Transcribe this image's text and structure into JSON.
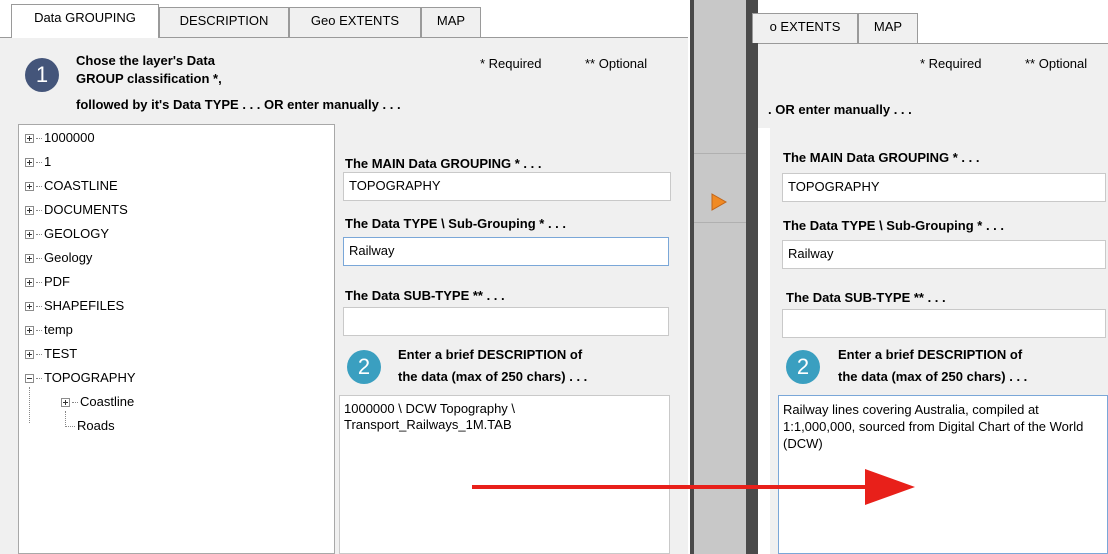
{
  "tabs": [
    "Data GROUPING",
    "DESCRIPTION",
    "Geo EXTENTS",
    "MAP"
  ],
  "right_tabs": [
    "o EXTENTS",
    "MAP"
  ],
  "header": {
    "step_number": "1",
    "line1": "Chose the layer's Data",
    "line2": "GROUP classification *,",
    "line3": "followed by it's Data TYPE . . . OR  enter manually . . .",
    "right_line3": ". OR  enter manually . . .",
    "required": "* Required",
    "optional": "** Optional"
  },
  "tree": {
    "items": [
      "1000000",
      "1",
      "COASTLINE",
      "DOCUMENTS",
      "GEOLOGY",
      "Geology",
      "PDF",
      "SHAPEFILES",
      "temp",
      "TEST",
      "TOPOGRAPHY"
    ],
    "children": [
      "Coastline",
      "Roads"
    ]
  },
  "form_left": {
    "main_label": "The MAIN Data GROUPING * . . .",
    "main_value": "TOPOGRAPHY",
    "type_label": "The Data TYPE \\ Sub-Grouping * . . .",
    "type_value": "Railway",
    "subtype_label": "The Data SUB-TYPE ** . . .",
    "subtype_value": "",
    "step2_number": "2",
    "desc_line1": "Enter a brief DESCRIPTION of",
    "desc_line2": "the data (max of 250 chars) . . .",
    "desc_value": "1000000 \\ DCW Topography \\\nTransport_Railways_1M.TAB"
  },
  "form_right": {
    "main_label": "The MAIN Data GROUPING * . . .",
    "main_value": "TOPOGRAPHY",
    "type_label": "The Data TYPE \\ Sub-Grouping * . . .",
    "type_value": "Railway",
    "subtype_label": "The Data SUB-TYPE ** . . .",
    "subtype_value": "",
    "step2_number": "2",
    "desc_line1": "Enter a brief DESCRIPTION of",
    "desc_line2": "the data (max of 250 chars) . . .",
    "desc_value": "Railway lines covering Australia, compiled at 1:1,000,000, sourced from Digital Chart of the World (DCW)"
  },
  "colors": {
    "step1": "#44557a",
    "step2": "#3a9fc0",
    "arrow": "#e8201a",
    "play": "#f08a24",
    "divider": "#c8c8c8"
  }
}
